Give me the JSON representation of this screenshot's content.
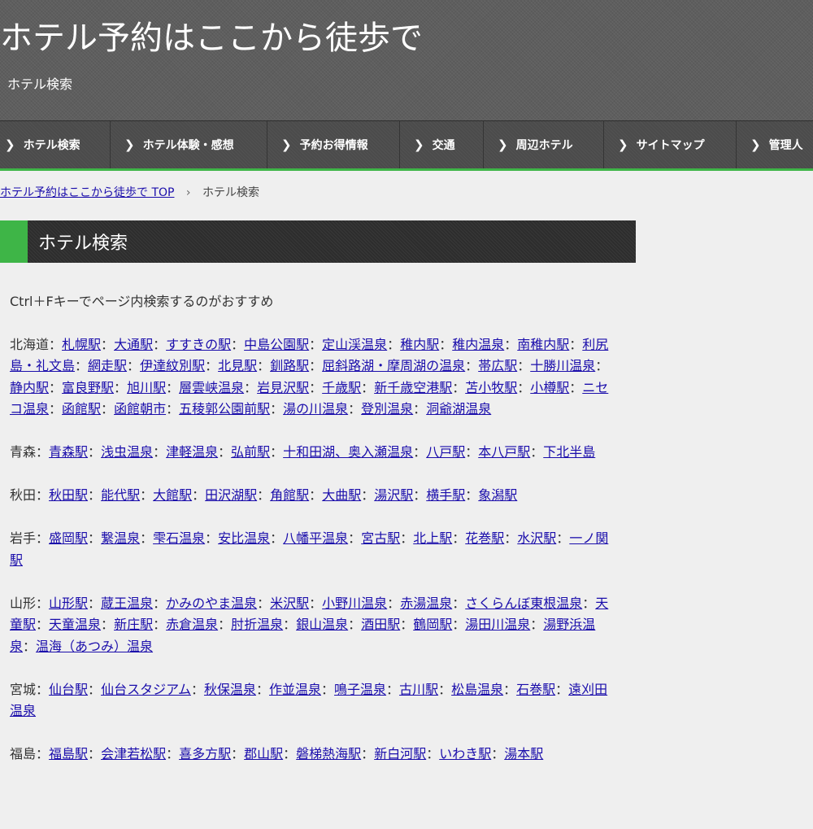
{
  "header": {
    "title": "ホテル予約はここから徒歩で",
    "subtitle": "ホテル検索"
  },
  "nav": {
    "chevron": "❯",
    "items": [
      {
        "label": "ホテル検索"
      },
      {
        "label": "ホテル体験・感想"
      },
      {
        "label": "予約お得情報"
      },
      {
        "label": "交通"
      },
      {
        "label": "周辺ホテル"
      },
      {
        "label": "サイトマップ"
      },
      {
        "label": "管理人"
      }
    ]
  },
  "breadcrumb": {
    "home": "ホテル予約はここから徒歩で TOP",
    "separator": "›",
    "current": "ホテル検索"
  },
  "page": {
    "heading": "ホテル検索",
    "tip": "Ctrl＋Fキーでページ内検索するのがおすすめ"
  },
  "regions": [
    {
      "name": "北海道",
      "links": [
        "札幌駅",
        "大通駅",
        "すすきの駅",
        "中島公園駅",
        "定山渓温泉",
        "稚内駅",
        "稚内温泉",
        "南稚内駅",
        "利尻島・礼文島",
        "網走駅",
        "伊達紋別駅",
        "北見駅",
        "釧路駅",
        "屈斜路湖・摩周湖の温泉",
        "帯広駅",
        "十勝川温泉",
        "静内駅",
        "富良野駅",
        "旭川駅",
        "層雲峡温泉",
        "岩見沢駅",
        "千歳駅",
        "新千歳空港駅",
        "苫小牧駅",
        "小樽駅",
        "ニセコ温泉",
        "函館駅",
        "函館朝市",
        "五稜郭公園前駅",
        "湯の川温泉",
        "登別温泉",
        "洞爺湖温泉"
      ]
    },
    {
      "name": "青森",
      "links": [
        "青森駅",
        "浅虫温泉",
        "津軽温泉",
        "弘前駅",
        "十和田湖、奥入瀬温泉",
        "八戸駅",
        "本八戸駅",
        "下北半島"
      ]
    },
    {
      "name": "秋田",
      "links": [
        "秋田駅",
        "能代駅",
        "大館駅",
        "田沢湖駅",
        "角館駅",
        "大曲駅",
        "湯沢駅",
        "横手駅",
        "象潟駅"
      ]
    },
    {
      "name": "岩手",
      "links": [
        "盛岡駅",
        "繋温泉",
        "雫石温泉",
        "安比温泉",
        "八幡平温泉",
        "宮古駅",
        "北上駅",
        "花巻駅",
        "水沢駅",
        "一ノ関駅"
      ]
    },
    {
      "name": "山形",
      "links": [
        "山形駅",
        "蔵王温泉",
        "かみのやま温泉",
        "米沢駅",
        "小野川温泉",
        "赤湯温泉",
        "さくらんぼ東根温泉",
        "天童駅",
        "天童温泉",
        "新庄駅",
        "赤倉温泉",
        "肘折温泉",
        "銀山温泉",
        "酒田駅",
        "鶴岡駅",
        "湯田川温泉",
        "湯野浜温泉",
        "温海（あつみ）温泉"
      ]
    },
    {
      "name": "宮城",
      "links": [
        "仙台駅",
        "仙台スタジアム",
        "秋保温泉",
        "作並温泉",
        "鳴子温泉",
        "古川駅",
        "松島温泉",
        "石巻駅",
        "遠刈田温泉"
      ]
    },
    {
      "name": "福島",
      "links": [
        "福島駅",
        "会津若松駅",
        "喜多方駅",
        "郡山駅",
        "磐梯熱海駅",
        "新白河駅",
        "いわき駅",
        "湯本駅"
      ]
    }
  ]
}
